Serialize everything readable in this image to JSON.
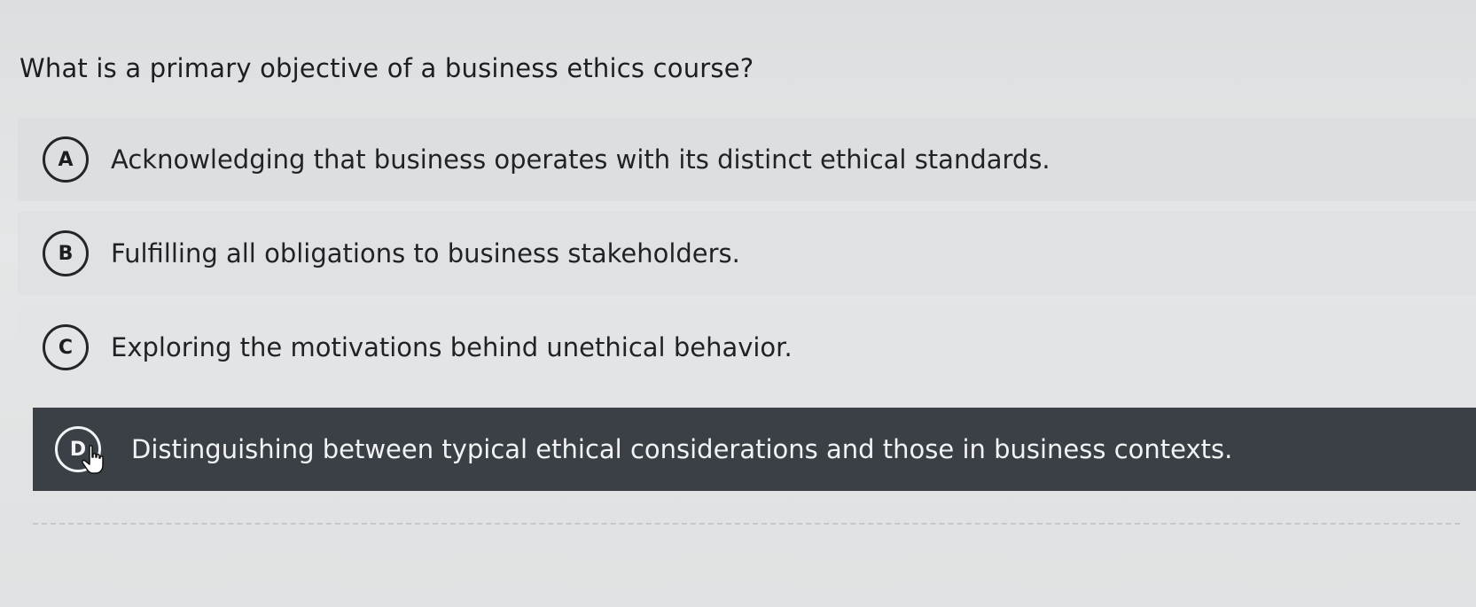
{
  "question": "What is a primary objective of a business ethics course?",
  "options": [
    {
      "letter": "A",
      "text": "Acknowledging that business operates with its distinct ethical standards.",
      "selected": false
    },
    {
      "letter": "B",
      "text": "Fulfilling all obligations to business stakeholders.",
      "selected": false
    },
    {
      "letter": "C",
      "text": "Exploring the motivations behind unethical behavior.",
      "selected": false
    },
    {
      "letter": "D",
      "text": "Distinguishing between typical ethical considerations and those in business contexts.",
      "selected": true
    }
  ],
  "colors": {
    "selected_background": "#3a4046",
    "selected_text": "#f2f3f4",
    "page_background": "#e0e2e3"
  },
  "icons": {
    "cursor": "hand-pointer-icon"
  }
}
